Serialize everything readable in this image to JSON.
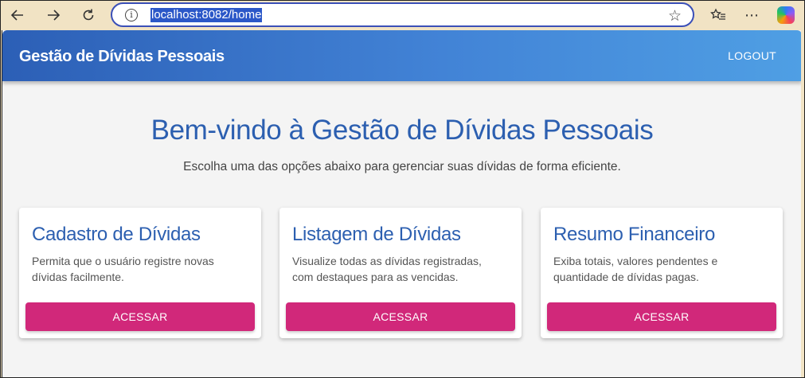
{
  "browser": {
    "url": "localhost:8082/home",
    "back_icon": "arrow-left-icon",
    "forward_icon": "arrow-right-icon",
    "reload_icon": "reload-icon"
  },
  "app": {
    "title": "Gestão de Dívidas Pessoais",
    "logout_label": "LOGOUT",
    "colors": {
      "primary": "#2c5fb6",
      "accent": "#d1287a"
    }
  },
  "hero": {
    "title": "Bem-vindo à Gestão de Dívidas Pessoais",
    "subtitle": "Escolha uma das opções abaixo para gerenciar suas dívidas de forma eficiente."
  },
  "cards": [
    {
      "title": "Cadastro de Dívidas",
      "description": "Permita que o usuário registre novas dívidas facilmente.",
      "button": "ACESSAR"
    },
    {
      "title": "Listagem de Dívidas",
      "description": "Visualize todas as dívidas registradas, com destaques para as vencidas.",
      "button": "ACESSAR"
    },
    {
      "title": "Resumo Financeiro",
      "description": "Exiba totais, valores pendentes e quantidade de dívidas pagas.",
      "button": "ACESSAR"
    }
  ]
}
